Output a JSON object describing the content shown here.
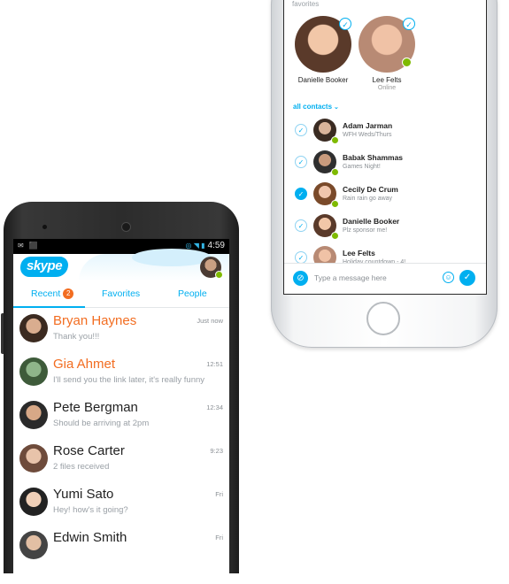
{
  "iphone": {
    "favorites_label": "favorites",
    "favorites": [
      {
        "name": "Danielle Booker",
        "status": "",
        "online": false,
        "colors": [
          "#f2c7a8",
          "#5a3a2a"
        ]
      },
      {
        "name": "Lee Felts",
        "status": "Online",
        "online": true,
        "colors": [
          "#f0c2a6",
          "#b88a74"
        ]
      }
    ],
    "all_contacts_label": "all contacts",
    "contacts": [
      {
        "name": "Adam Jarman",
        "status": "WFH Weds/Thurs",
        "checked": false,
        "presence": "#7fba00",
        "colors": [
          "#d9b49a",
          "#3a2b22"
        ]
      },
      {
        "name": "Babak Shammas",
        "status": "Games Night!",
        "checked": false,
        "presence": "#7fba00",
        "colors": [
          "#c99b7d",
          "#2f2f2f"
        ]
      },
      {
        "name": "Cecily De Crum",
        "status": "Rain rain go away",
        "checked": true,
        "presence": "#7fba00",
        "colors": [
          "#f0c6ad",
          "#7a4a2a"
        ]
      },
      {
        "name": "Danielle Booker",
        "status": "Plz sponsor me!",
        "checked": false,
        "presence": "#7fba00",
        "colors": [
          "#f2c7a8",
          "#5a3a2a"
        ]
      },
      {
        "name": "Lee Felts",
        "status": "Holiday countdown - 4!",
        "checked": false,
        "presence": "#7fba00",
        "colors": [
          "#f0c2a6",
          "#b88a74"
        ]
      }
    ],
    "compose_placeholder": "Type a message here"
  },
  "android": {
    "status_time": "4:59",
    "logo": "skype",
    "tabs": [
      {
        "label": "Recent",
        "badge": "2"
      },
      {
        "label": "Favorites"
      },
      {
        "label": "People"
      }
    ],
    "chats": [
      {
        "name": "Bryan Haynes",
        "preview": "Thank you!!!",
        "time": "Just now",
        "unread": true,
        "colors": [
          "#d9ad8f",
          "#3b2a20"
        ]
      },
      {
        "name": "Gia Ahmet",
        "preview": "I'll send you the link later, it's really funny",
        "time": "12:51",
        "unread": true,
        "colors": [
          "#8fb58a",
          "#3e5b3a"
        ]
      },
      {
        "name": "Pete Bergman",
        "preview": "Should be arriving at 2pm",
        "time": "12:34",
        "unread": false,
        "colors": [
          "#d7a887",
          "#2a2a2a"
        ]
      },
      {
        "name": "Rose Carter",
        "preview": "2 files received",
        "time": "9:23",
        "unread": false,
        "colors": [
          "#e8c3aa",
          "#6e4b3b"
        ]
      },
      {
        "name": "Yumi Sato",
        "preview": "Hey! how's it going?",
        "time": "Fri",
        "unread": false,
        "colors": [
          "#f0d0b8",
          "#222222"
        ]
      },
      {
        "name": "Edwin Smith",
        "preview": "",
        "time": "Fri",
        "unread": false,
        "colors": [
          "#e2bfa4",
          "#444444"
        ]
      }
    ]
  },
  "colors": {
    "accent": "#00aff0",
    "unread": "#f26d21",
    "online": "#7fba00"
  }
}
